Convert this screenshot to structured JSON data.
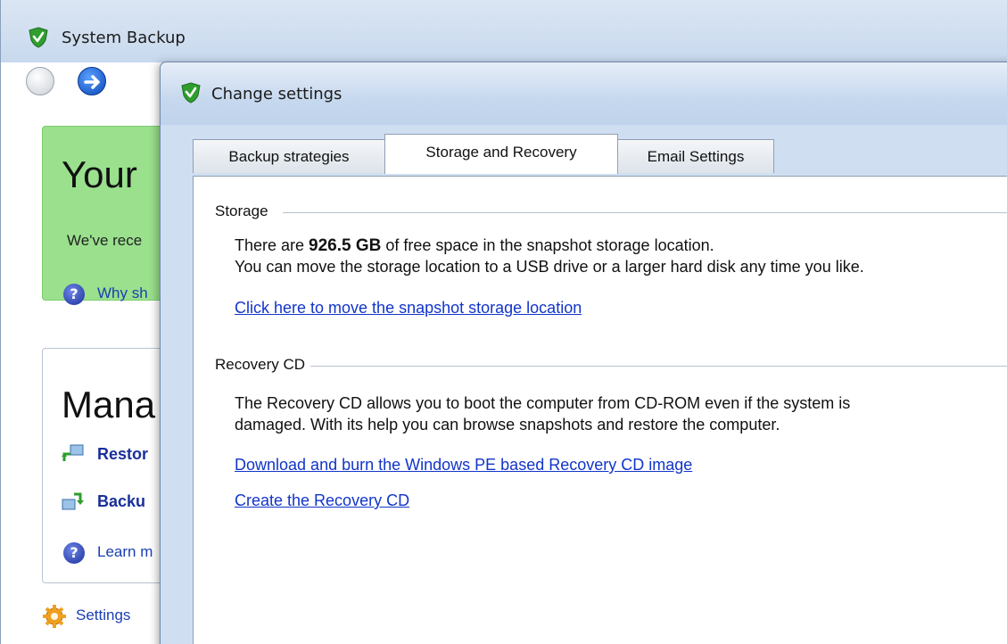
{
  "main_window": {
    "title": "System Backup",
    "status_panel": {
      "title": "Your",
      "text": "We've rece",
      "why_link": "Why sh"
    },
    "manage_panel": {
      "title": "Mana",
      "restore_label": "Restor",
      "backup_label": "Backu",
      "learn_link": "Learn m"
    },
    "settings_link": "Settings"
  },
  "dialog": {
    "title": "Change settings",
    "tabs": [
      {
        "label": "Backup strategies"
      },
      {
        "label": "Storage and Recovery"
      },
      {
        "label": "Email Settings"
      }
    ],
    "storage": {
      "heading": "Storage",
      "line1_prefix": "There are ",
      "free_space": "926.5 GB",
      "line1_suffix": " of free space in the snapshot storage location.",
      "line2": "You can move the storage location to a USB drive or a larger hard disk any time you like.",
      "move_link": "Click here to move the snapshot storage location"
    },
    "recovery": {
      "heading": "Recovery CD",
      "line1": "The Recovery CD allows you to boot the computer from CD-ROM even if the system is",
      "line2": "damaged. With its help you can browse snapshots and restore the computer.",
      "download_link": "Download and burn the Windows PE based Recovery CD image",
      "create_link": "Create the Recovery CD"
    }
  },
  "colors": {
    "status_green": "#9ae08d",
    "link_blue": "#1235c9",
    "shield_green": "#3bb03b"
  }
}
